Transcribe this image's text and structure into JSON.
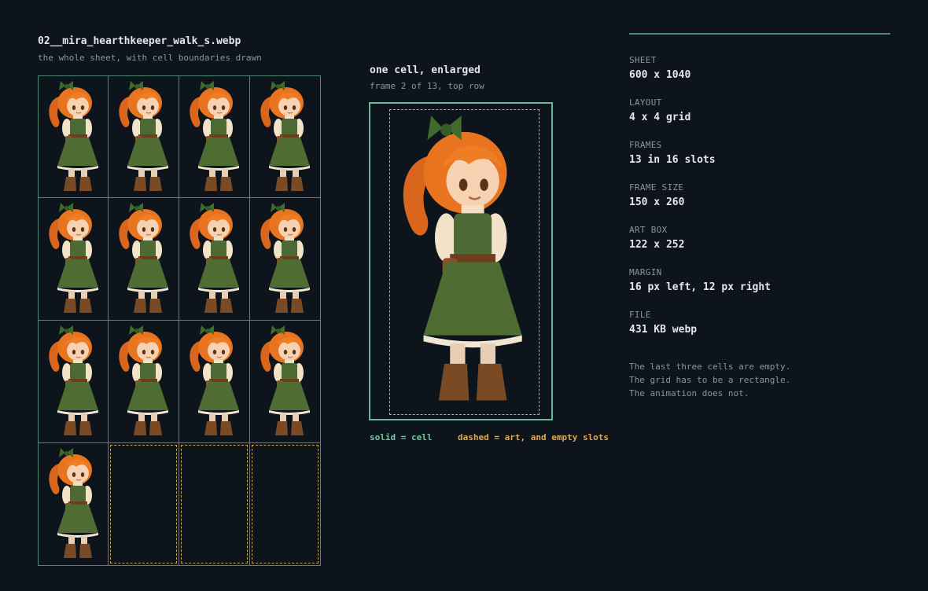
{
  "sheet_panel": {
    "filename": "02__mira_hearthkeeper_walk_s.webp",
    "caption": "the whole sheet, with cell boundaries drawn",
    "cells": [
      {
        "filled": true
      },
      {
        "filled": true
      },
      {
        "filled": true
      },
      {
        "filled": true
      },
      {
        "filled": true
      },
      {
        "filled": true
      },
      {
        "filled": true
      },
      {
        "filled": true
      },
      {
        "filled": true
      },
      {
        "filled": true
      },
      {
        "filled": true
      },
      {
        "filled": true
      },
      {
        "filled": true
      },
      {
        "filled": false
      },
      {
        "filled": false
      },
      {
        "filled": false
      }
    ]
  },
  "enlarged_panel": {
    "title": "one cell, enlarged",
    "caption": "frame 2 of 13, top row",
    "legend_solid": "solid = cell",
    "legend_dashed": "dashed = art, and empty slots"
  },
  "stats": [
    {
      "label": "SHEET",
      "value": "600 x 1040"
    },
    {
      "label": "LAYOUT",
      "value": "4 x 4 grid"
    },
    {
      "label": "FRAMES",
      "value": "13 in 16 slots"
    },
    {
      "label": "FRAME SIZE",
      "value": "150 x 260"
    },
    {
      "label": "ART BOX",
      "value": "122 x 252"
    },
    {
      "label": "MARGIN",
      "value": "16 px left, 12 px right"
    },
    {
      "label": "FILE",
      "value": "431 KB webp"
    }
  ],
  "notes": [
    "The last three cells are empty.",
    "The grid has to be a rectangle.",
    "The animation does not."
  ],
  "colors": {
    "background": "#0e141c",
    "cell_border": "#4f8a72",
    "art_dashed": "#e0a84e",
    "legend_solid": "#6fc7a0",
    "legend_dashed": "#e0a84e"
  },
  "icons": [
    "character-sprite-icon"
  ]
}
